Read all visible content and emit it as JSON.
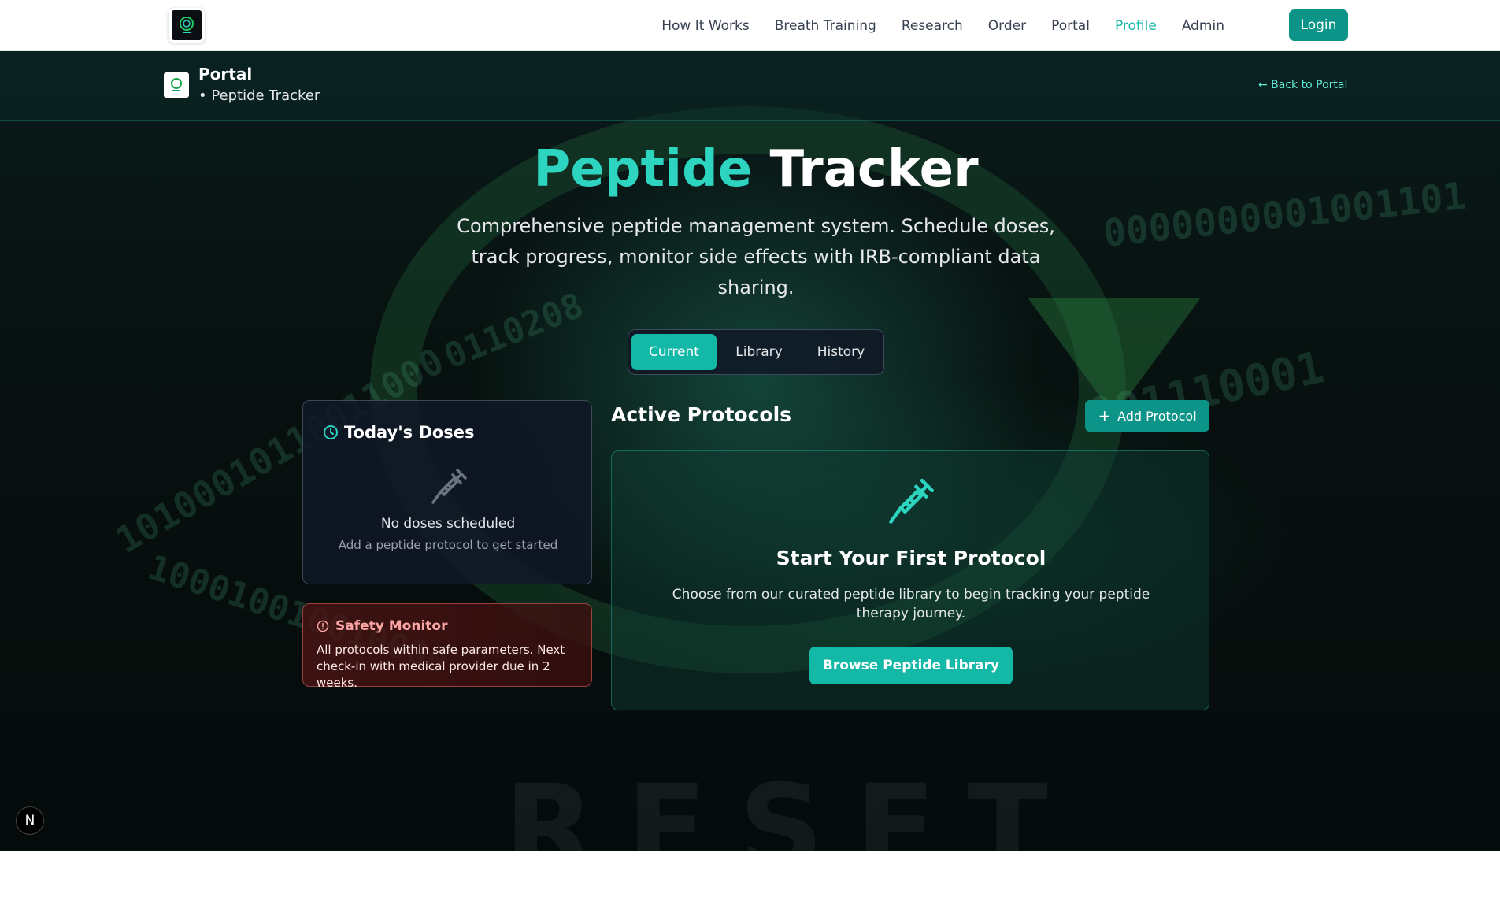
{
  "nav": {
    "links": [
      "How It Works",
      "Breath Training",
      "Research",
      "Order",
      "Portal",
      "Profile",
      "Admin"
    ],
    "active_link": "Profile",
    "login_label": "Login"
  },
  "subheader": {
    "title": "Portal",
    "subtitle": "• Peptide Tracker",
    "back_link": "← Back to Portal"
  },
  "hero": {
    "title_accent": "Peptide",
    "title_rest": "Tracker",
    "description": "Comprehensive peptide management system. Schedule doses, track progress, monitor side effects with IRB-compliant data sharing."
  },
  "tabs": {
    "items": [
      "Current",
      "Library",
      "History"
    ],
    "active": "Current"
  },
  "doses": {
    "title": "Today's Doses",
    "empty_title": "No doses scheduled",
    "empty_subtitle": "Add a peptide protocol to get started"
  },
  "safety": {
    "title": "Safety Monitor",
    "text": "All protocols within safe parameters. Next check-in with medical provider due in 2 weeks."
  },
  "protocols": {
    "title": "Active Protocols",
    "add_label": "Add Protocol",
    "empty_title": "Start Your First Protocol",
    "empty_desc": "Choose from our curated peptide library to begin tracking your peptide therapy journey.",
    "browse_label": "Browse Peptide Library"
  },
  "watermark": "RESET",
  "badge": "N",
  "colors": {
    "accent": "#14b8a6",
    "accent_light": "#2dd4bf",
    "danger": "#fca5a5"
  }
}
